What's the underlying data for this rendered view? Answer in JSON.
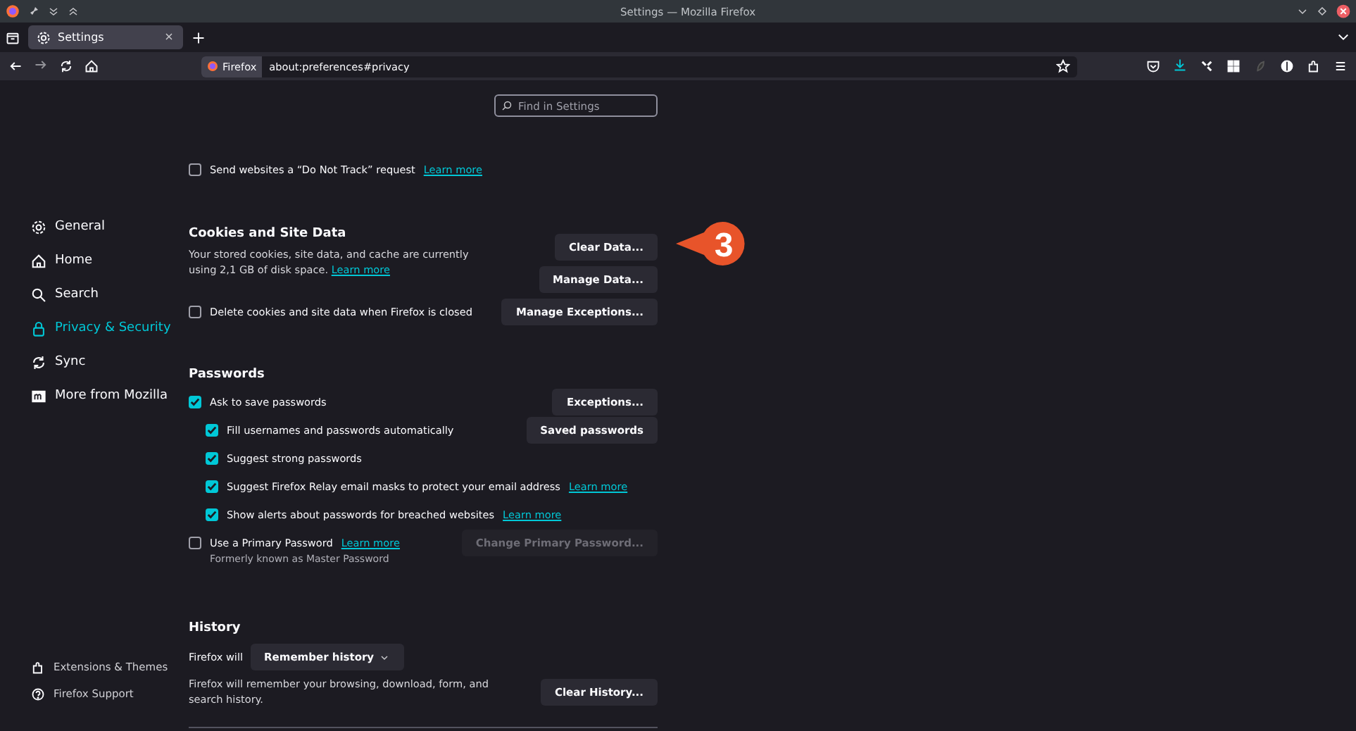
{
  "window": {
    "title": "Settings — Mozilla Firefox"
  },
  "tabs": [
    {
      "label": "Settings",
      "selected": true
    }
  ],
  "url_bar": {
    "identity": "Firefox",
    "url": "about:preferences#privacy"
  },
  "search": {
    "placeholder": "Find in Settings"
  },
  "sidebar": {
    "items": [
      {
        "label": "General",
        "selected": false
      },
      {
        "label": "Home",
        "selected": false
      },
      {
        "label": "Search",
        "selected": false
      },
      {
        "label": "Privacy & Security",
        "selected": true
      },
      {
        "label": "Sync",
        "selected": false
      },
      {
        "label": "More from Mozilla",
        "selected": false
      }
    ],
    "footer_items": [
      {
        "label": "Extensions & Themes"
      },
      {
        "label": "Firefox Support"
      }
    ]
  },
  "tracking_rows": [
    {
      "label": "Send websites a “Do Not Track” request",
      "link": "Learn more",
      "checked": false
    }
  ],
  "cookies": {
    "heading": "Cookies and Site Data",
    "description": "Your stored cookies, site data, and cache are currently using 2,1 GB of disk space.",
    "link": "Learn more",
    "checkbox": {
      "label": "Delete cookies and site data when Firefox is closed",
      "checked": false
    },
    "buttons": [
      "Clear Data...",
      "Manage Data...",
      "Manage Exceptions..."
    ]
  },
  "callout": {
    "number": "3"
  },
  "passwords": {
    "heading": "Passwords",
    "items": [
      {
        "label": "Ask to save passwords",
        "checked": true,
        "button": {
          "label": "Exceptions...",
          "disabled": false
        },
        "children": [
          {
            "label": "Fill usernames and passwords automatically",
            "checked": true,
            "button": {
              "label": "Saved passwords",
              "disabled": false
            }
          },
          {
            "label": "Suggest strong passwords",
            "checked": true
          },
          {
            "label": "Suggest Firefox Relay email masks to protect your email address",
            "checked": true,
            "link": "Learn more"
          },
          {
            "label": "Show alerts about passwords for breached websites",
            "checked": true,
            "link": "Learn more"
          }
        ]
      },
      {
        "label": "Use a Primary Password",
        "checked": false,
        "link": "Learn more",
        "note": "Formerly known as Master Password",
        "button": {
          "label": "Change Primary Password...",
          "disabled": true
        }
      }
    ]
  },
  "history": {
    "heading": "History",
    "label": "Firefox will",
    "dropdown": "Remember history",
    "description": "Firefox will remember your browsing, download, form, and search history.",
    "button": "Clear History..."
  }
}
